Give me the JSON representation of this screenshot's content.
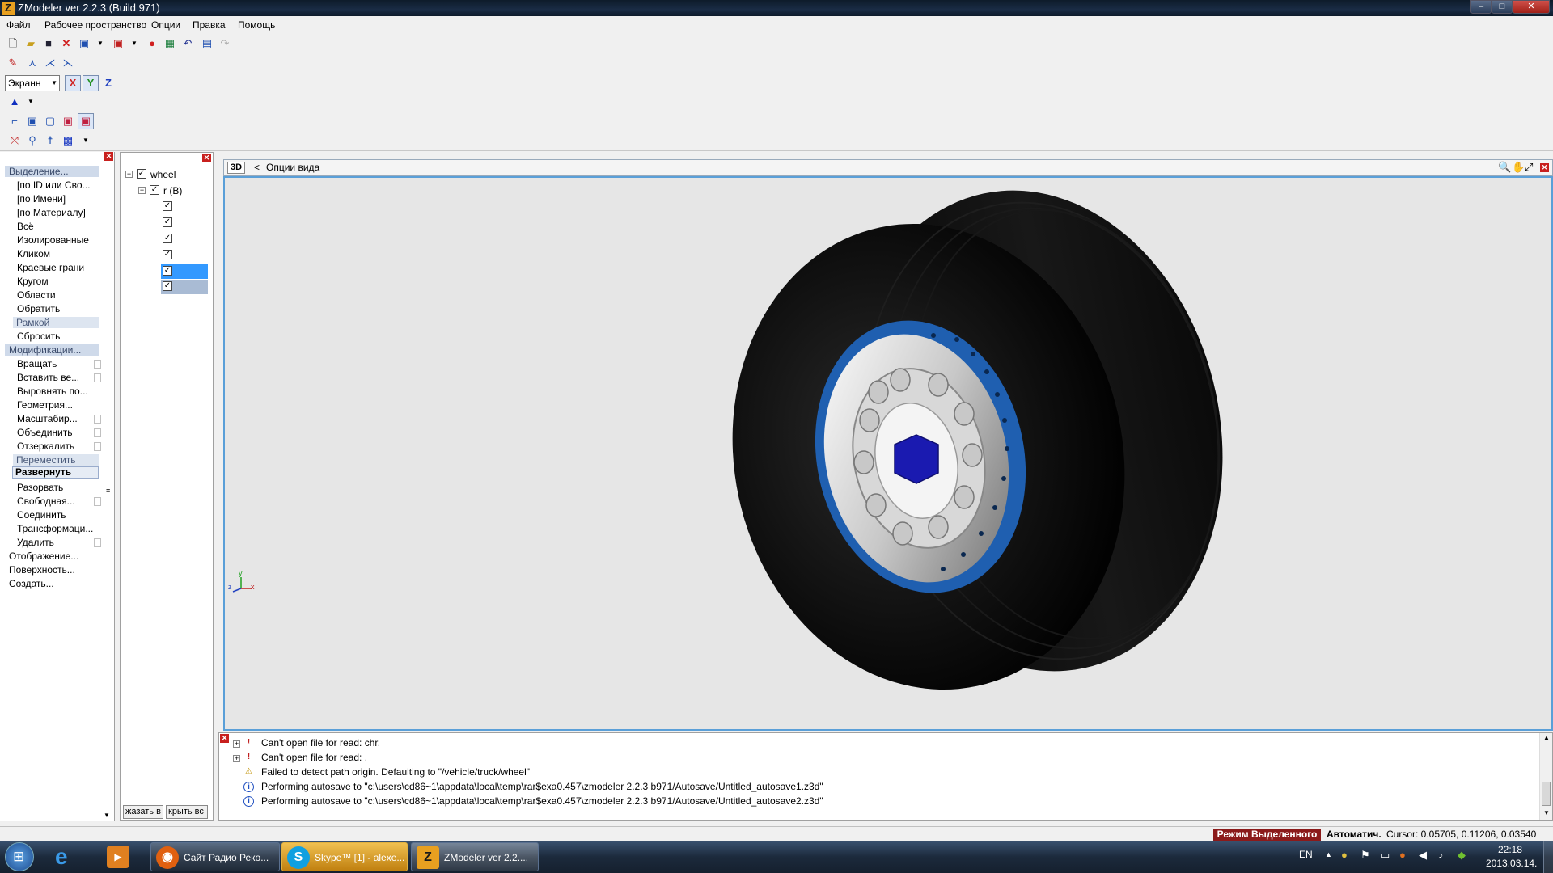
{
  "window": {
    "title": "ZModeler ver 2.2.3 (Build 971)",
    "minimize": "–",
    "maximize": "□",
    "close": "✕"
  },
  "menu": [
    "Файл",
    "Рабочее пространство",
    "Опции",
    "Правка",
    "Помощь"
  ],
  "toolbar": {
    "coord_select": "Экранн",
    "axis_x": "X",
    "axis_y": "Y",
    "axis_z": "Z"
  },
  "left_panel": {
    "selection_header": "Выделение...",
    "selection_items": [
      "[по ID или Сво...",
      "[по Имени]",
      "[по Материалу]",
      "Всё",
      "Изолированные",
      "Кликом",
      "Краевые грани",
      "Кругом",
      "Области",
      "Обратить"
    ],
    "frame_item": "Рамкой",
    "reset_item": "Сбросить",
    "modifications_header": "Модификации...",
    "modifications_items": [
      "Вращать",
      "Вставить ве...",
      "Выровнять по...",
      "Геометрия...",
      "Масштабир...",
      "Объединить",
      "Отзеркалить"
    ],
    "move_item": "Переместить",
    "expand_item": "Развернуть",
    "mod_items2": [
      "Разорвать",
      "Свободная...",
      "Соединить",
      "Трансформаци...",
      "Удалить"
    ],
    "bottom_items": [
      "Отображение...",
      "Поверхность...",
      "Создать..."
    ]
  },
  "tree": {
    "root": "wheel",
    "child": "r (B)",
    "buttons": [
      "жазать в",
      "крыть вс"
    ]
  },
  "viewport": {
    "mode": "3D",
    "options_label": "Опции вида",
    "back_arrow": "<",
    "axis_labels": [
      "z",
      "y",
      "x"
    ]
  },
  "log": [
    {
      "type": "error",
      "text": "Can't open file for read: chr."
    },
    {
      "type": "error",
      "text": "Can't open file for read: ."
    },
    {
      "type": "warning",
      "text": "Failed to detect path origin. Defaulting to \"/vehicle/truck/wheel\""
    },
    {
      "type": "info",
      "text": "Performing autosave to \"c:\\users\\cd86~1\\appdata\\local\\temp\\rar$exa0.457\\zmodeler 2.2.3 b971/Autosave/Untitled_autosave1.z3d\""
    },
    {
      "type": "info",
      "text": "Performing autosave to \"c:\\users\\cd86~1\\appdata\\local\\temp\\rar$exa0.457\\zmodeler 2.2.3 b971/Autosave/Untitled_autosave2.z3d\""
    }
  ],
  "status": {
    "mode": "Режим Выделенного",
    "auto": "Автоматич.",
    "cursor": "Cursor: 0.05705, 0.11206, 0.03540"
  },
  "taskbar": {
    "tasks": [
      "Сайт Радио Реко...",
      "Skype™ [1] - alexe...",
      "ZModeler ver 2.2...."
    ],
    "lang": "EN",
    "time": "22:18",
    "date": "2013.03.14."
  },
  "colors": {
    "accent": "#3399ff",
    "error_status": "#8b1a1a",
    "rim_blue": "#1f5fb0",
    "hub_blue": "#1a1ab0"
  }
}
